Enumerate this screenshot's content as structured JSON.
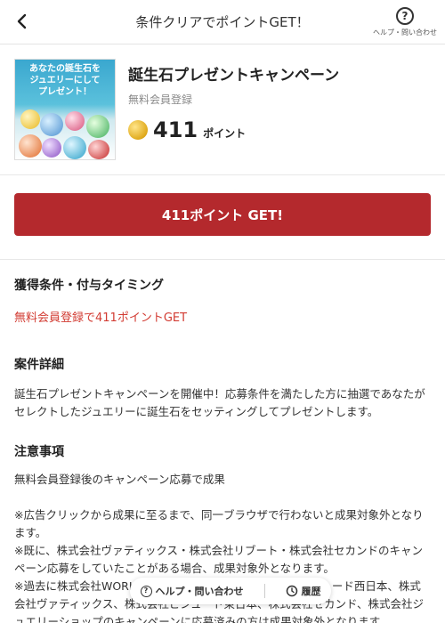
{
  "header": {
    "title": "条件クリアでポイントGET！",
    "help_label": "ヘルプ・問い合わせ",
    "help_icon": "?"
  },
  "campaign": {
    "image_text": [
      "あなたの誕生石を",
      "ジュエリーにして",
      "プレゼント！"
    ],
    "title": "誕生石プレゼントキャンペーン",
    "subtitle": "無料会員登録",
    "points": "411",
    "points_unit": "ポイント"
  },
  "get_button": {
    "label": "411ポイント GET!"
  },
  "conditions": {
    "heading": "獲得条件・付与タイミング",
    "text": "無料会員登録で411ポイントGET"
  },
  "details": {
    "heading": "案件詳細",
    "text": "誕生石プレゼントキャンペーンを開催中！応募条件を満たした方に抽選であなたがセレクトしたジュエリーに誕生石をセッティングしてプレゼントします。"
  },
  "notes": {
    "heading": "注意事項",
    "line1": "無料会員登録後のキャンペーン応募で成果",
    "line2": "※広告クリックから成果に至るまで、同一ブラウザで行わないと成果対象外となります。",
    "line3": "※既に、株式会社ヴァティックス・株式会社リブート・株式会社セカンドのキャンペーン応募をしていたことがある場合、成果対象外となります。",
    "line4": "※過去に株式会社WORLD、株式会社リブート、株式会社ビジュード西日本、株式会社ヴァティックス、株式会社ビジュード東日本、株式会社セカンド、株式会社ジュエリーショップのキャンペーンに応募済みの方は成果対象外となります。"
  },
  "bottom_bar": {
    "help_label": "ヘルプ・問い合わせ",
    "history_label": "履歴"
  },
  "colors": {
    "accent_red": "#b4292d",
    "condition_red": "#d23b32"
  },
  "icons": [
    "back-arrow-icon",
    "help-icon",
    "coin-icon",
    "history-icon"
  ]
}
